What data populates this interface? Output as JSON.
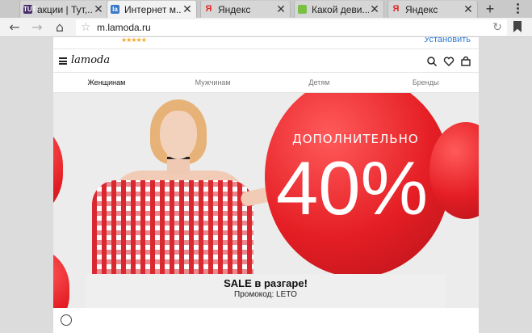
{
  "browser": {
    "tabs": [
      {
        "favicon_text": "TUT",
        "favicon_color": "#4a2d6b",
        "title": "акции | Тут,...",
        "active": false
      },
      {
        "favicon_text": "la",
        "favicon_color": "#3a78c9",
        "title": "Интернет м...",
        "active": true
      },
      {
        "favicon_text": "Я",
        "favicon_color": "#e7e7e7",
        "title": "Яндекс",
        "active": false
      },
      {
        "favicon_text": "",
        "favicon_color": "#7ac143",
        "title": "Какой деви...",
        "active": false
      },
      {
        "favicon_text": "Я",
        "favicon_color": "#e7e7e7",
        "title": "Яндекс",
        "active": false
      }
    ],
    "new_tab_label": "+",
    "url": "m.lamoda.ru"
  },
  "page": {
    "install_label": "Установить",
    "logo": "lamoda",
    "nav": [
      "Женщинам",
      "Мужчинам",
      "Детям",
      "Бренды"
    ],
    "active_nav": "Женщинам",
    "banner": {
      "discount_label": "ДОПОЛНИТЕЛЬНО",
      "discount_value": "40%",
      "sale_title": "SALE в разгаре!",
      "promo_code": "Промокод: LETO"
    }
  },
  "colors": {
    "accent": "#e41e24",
    "link": "#2d7ad6"
  }
}
